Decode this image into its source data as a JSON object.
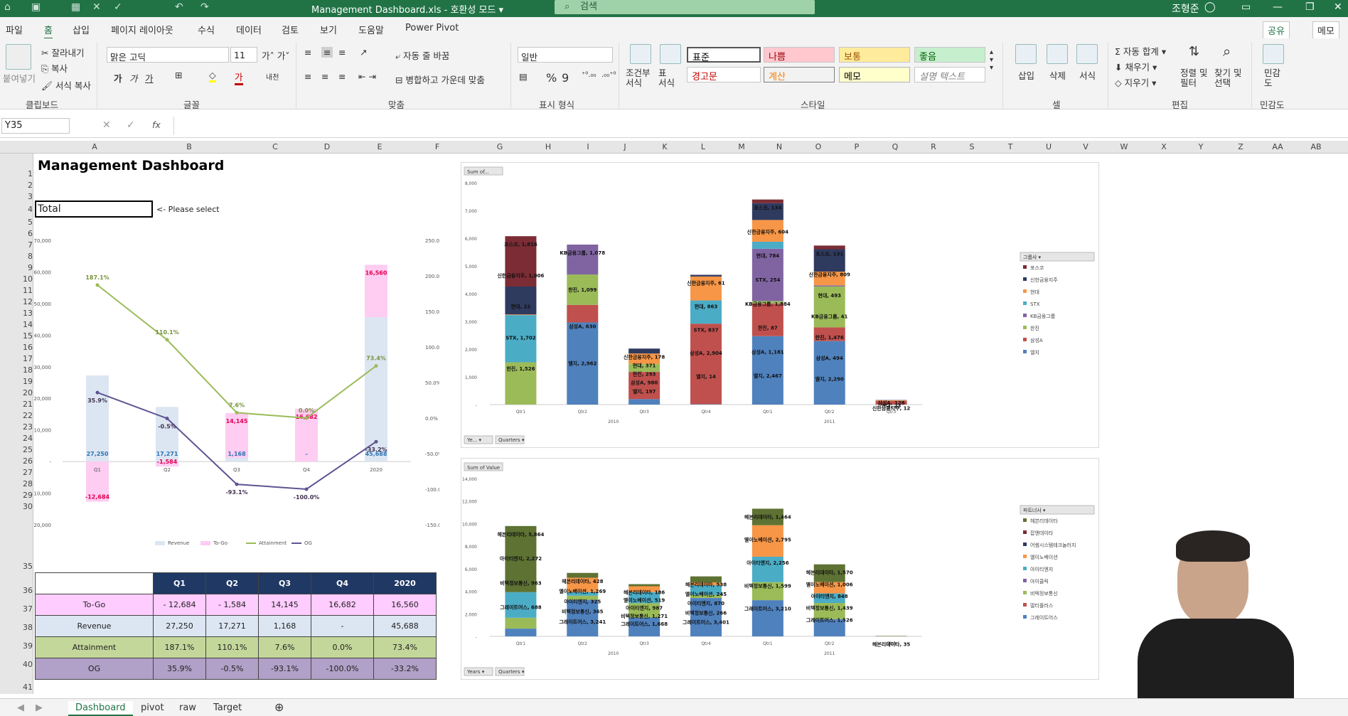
{
  "titlebar": {
    "title": "Management Dashboard.xls  -  호환성 모드  ▾",
    "search_placeholder": "검색",
    "user": "조형준"
  },
  "menu": [
    "파일",
    "홈",
    "삽입",
    "페이지 레이아웃",
    "수식",
    "데이터",
    "검토",
    "보기",
    "도움말",
    "Power Pivot"
  ],
  "share": [
    "공유",
    "메모"
  ],
  "ribbon": {
    "paste": "붙여넣기",
    "cut": "잘라내기",
    "copy": "복사",
    "format_painter": "서식 복사",
    "font_name": "맑은 고딕",
    "font_size": "11",
    "wrap": "자동 줄 바꿈",
    "merge": "병합하고 가운데 맞춤",
    "number_format": "일반",
    "cond_format": "조건부\n서식",
    "table_format": "표\n서식",
    "styles": [
      {
        "label": "표준",
        "color": "#000000",
        "bg": "#ffffff"
      },
      {
        "label": "나쁨",
        "color": "#9c0006",
        "bg": "#ffc7ce"
      },
      {
        "label": "보통",
        "color": "#9c5700",
        "bg": "#ffeb9c"
      },
      {
        "label": "좋음",
        "color": "#006100",
        "bg": "#c6efce"
      },
      {
        "label": "경고문",
        "color": "#c00000",
        "bg": "#ffffff"
      },
      {
        "label": "계산",
        "color": "#fa7d00",
        "bg": "#f2f2f2"
      },
      {
        "label": "메모",
        "color": "#000000",
        "bg": "#ffffcc"
      },
      {
        "label": "설명 텍스트",
        "color": "#7f7f7f",
        "bg": "#ffffff"
      }
    ],
    "insert": "삽입",
    "delete": "삭제",
    "format": "서식",
    "autosum": "자동 합계",
    "fill": "채우기",
    "clear": "지우기",
    "sort": "정렬 및\n필터",
    "find": "찾기 및\n선택",
    "sensitivity": "민감\n도",
    "groups": [
      "클립보드",
      "글꼴",
      "맞춤",
      "표시 형식",
      "스타일",
      "셀",
      "편집",
      "민감도"
    ]
  },
  "formula": {
    "cell": "Y35",
    "fx": "fx"
  },
  "columns": [
    "A",
    "B",
    "C",
    "D",
    "E",
    "F",
    "G",
    "H",
    "I",
    "J",
    "K",
    "L",
    "M",
    "N",
    "O",
    "P",
    "Q",
    "R",
    "S",
    "T",
    "U",
    "V",
    "W",
    "X",
    "Y",
    "Z",
    "AA",
    "AB",
    "AC",
    "AD"
  ],
  "rows": [
    "1",
    "2",
    "3",
    "4",
    "5",
    "6",
    "7",
    "8",
    "9",
    "10",
    "11",
    "12",
    "13",
    "14",
    "15",
    "16",
    "17",
    "18",
    "19",
    "20",
    "21",
    "22",
    "23",
    "24",
    "25",
    "26",
    "27",
    "28",
    "29",
    "30",
    "35",
    "36",
    "37",
    "38",
    "39",
    "40",
    "41"
  ],
  "dashboard": {
    "title": "Management Dashboard",
    "select_value": "Total",
    "select_hint": "<- Please select"
  },
  "combo_chart": {
    "categories": [
      "Q1",
      "Q2",
      "Q3",
      "Q4",
      "2020"
    ],
    "revenue": [
      27250,
      17271,
      1168,
      0,
      45688
    ],
    "to_go": [
      -12684,
      -1584,
      14145,
      16682,
      16560
    ],
    "attainment": [
      187.1,
      110.1,
      7.6,
      0.0,
      73.4
    ],
    "og": [
      35.9,
      -0.5,
      -93.1,
      -100.0,
      -33.2
    ],
    "revenue_labels": [
      "27,250",
      "17,271",
      "1,168",
      "-",
      "45,688"
    ],
    "togo_labels": [
      "-12,684",
      "-1,584",
      "14,145",
      "16,682",
      "16,560"
    ],
    "att_labels": [
      "187.1%",
      "110.1%",
      "7.6%",
      "0.0%",
      "73.4%"
    ],
    "og_labels": [
      "35.9%",
      "-0.5%",
      "-93.1%",
      "-100.0%",
      "-33.2%"
    ],
    "y_left": [
      "70,000",
      "60,000",
      "50,000",
      "40,000",
      "30,000",
      "20,000",
      "10,000",
      "-",
      "-10,000",
      "-20,000"
    ],
    "y_right": [
      "250.0%",
      "200.0%",
      "150.0%",
      "100.0%",
      "50.0%",
      "0.0%",
      "-50.0%",
      "-100.0%",
      "-150.0%"
    ],
    "legend": [
      "Revenue",
      "To-Go",
      "Attainment",
      "OG"
    ],
    "colors": {
      "revenue": "#dce6f2",
      "togo": "#ffccf2",
      "attainment": "#9bbb59",
      "og": "#5f5491"
    }
  },
  "table": {
    "headers": [
      "Q1",
      "Q2",
      "Q3",
      "Q4",
      "2020"
    ],
    "rows": [
      {
        "label": "To-Go",
        "bg": "#ffccff",
        "values": [
          "-      12,684",
          "-      1,584",
          "14,145",
          "16,682",
          "16,560"
        ]
      },
      {
        "label": "Revenue",
        "bg": "#dce6f2",
        "values": [
          "27,250",
          "17,271",
          "1,168",
          "-",
          "45,688"
        ]
      },
      {
        "label": "Attainment",
        "bg": "#c4d79b",
        "values": [
          "187.1%",
          "110.1%",
          "7.6%",
          "0.0%",
          "73.4%"
        ]
      },
      {
        "label": "OG",
        "bg": "#b1a0c7",
        "values": [
          "35.9%",
          "-0.5%",
          "-93.1%",
          "-100.0%",
          "-33.2%"
        ]
      }
    ]
  },
  "pivot1": {
    "field_button": "Sum of...",
    "y_labels": [
      "8,000",
      "7,000",
      "6,000",
      "5,000",
      "4,000",
      "3,000",
      "2,000",
      "1,000",
      "-"
    ],
    "quarters": [
      "Qtr1",
      "Qtr2",
      "Qtr3",
      "Qtr4",
      "Qtr1",
      "Qtr2",
      "Qtr3"
    ],
    "years": [
      "2010",
      "2011"
    ],
    "filters": [
      "Ye...",
      "Quarters"
    ],
    "legend_title": "그룹사",
    "legend": [
      {
        "name": "포스코",
        "color": "#7b2c34"
      },
      {
        "name": "신한금융지주",
        "color": "#2f3a5f"
      },
      {
        "name": "현대",
        "color": "#f79646"
      },
      {
        "name": "STX",
        "color": "#4bacc6"
      },
      {
        "name": "KB금융그룹",
        "color": "#8064a2"
      },
      {
        "name": "한진",
        "color": "#9bbb59"
      },
      {
        "name": "삼성A",
        "color": "#c0504d"
      },
      {
        "name": "엘지",
        "color": "#4f81bd"
      }
    ],
    "labels": [
      [
        "포스코, 1,816",
        "신한금융지주, 1,006",
        "현대, 22",
        "STX, 1,702",
        "한진, 1,526"
      ],
      [
        "KB금융그룹, 1,078",
        "한진, 1,099",
        "삼성A, 630",
        "엘지, 2,962"
      ],
      [
        "신한금융지주, 178",
        "현대, 371",
        "한진, 293",
        "삼성A, 980",
        "엘지, 197"
      ],
      [
        "신한금융지주, 61",
        "현대, 863",
        "STX, 837",
        "삼성A, 2,904",
        "엘지, 14"
      ],
      [
        "포스코, 134",
        "신한금융지주, 604",
        "현대, 784",
        "STX, 254",
        "KB금융그룹, 1,884",
        "한진, 87",
        "삼성A, 1,181",
        "엘지, 2,467"
      ],
      [
        "포스코, 131",
        "신한금융지주, 809",
        "현대, 493",
        "KB금융그룹, 41",
        "한진, 1,476",
        "삼성A, 494",
        "엘지, 2,290"
      ],
      [
        "신한금융지주, 12",
        "현대, 23",
        "삼성A, 128"
      ]
    ]
  },
  "pivot2": {
    "field_button": "Sum of Value",
    "y_labels": [
      "14,000",
      "12,000",
      "10,000",
      "8,000",
      "6,000",
      "4,000",
      "2,000",
      "-"
    ],
    "quarters": [
      "Qtr1",
      "Qtr2",
      "Qtr3",
      "Qtr4",
      "Qtr1",
      "Qtr2",
      "Qtr3"
    ],
    "years": [
      "2010",
      "2011"
    ],
    "filters": [
      "Years",
      "Quarters"
    ],
    "legend_title": "파트너사",
    "legend": [
      {
        "name": "헤븐리데이타",
        "color": "#5e7233"
      },
      {
        "name": "잡앤데이타",
        "color": "#7b2c34"
      },
      {
        "name": "어썸시스템테크놀러지",
        "color": "#2f3a5f"
      },
      {
        "name": "옐이노베이션",
        "color": "#f79646"
      },
      {
        "name": "아이티엔지",
        "color": "#4bacc6"
      },
      {
        "name": "아이클릭",
        "color": "#8064a2"
      },
      {
        "name": "비텍정보통신",
        "color": "#9bbb59"
      },
      {
        "name": "멀티플러스",
        "color": "#c0504d"
      },
      {
        "name": "그레이트어스",
        "color": "#4f81bd"
      }
    ],
    "labels": [
      [
        "헤븐리데이타, 5,864",
        "아이티엔지, 2,272",
        "비텍정보통신, 963",
        "그레이트어스, 688"
      ],
      [
        "헤븐리데이타, 428",
        "옐이노베이션, 1,269",
        "아이티엔지, 325",
        "비텍정보통신, 365",
        "그레이트어스, 3,241"
      ],
      [
        "헤븐리데이타, 186",
        "옐이노베이션, 519",
        "아이티엔지, 987",
        "비텍정보통신, 1,271",
        "그레이트어스, 1,668"
      ],
      [
        "헤븐리데이타, 538",
        "옐이노베이션, 245",
        "아이티엔지, 870",
        "비텍정보통신, 266",
        "그레이트어스, 3,401"
      ],
      [
        "헤븐리데이타, 1,464",
        "옐이노베이션, 2,795",
        "아이티엔지, 2,256",
        "비텍정보통신, 1,599",
        "그레이트어스, 3,210"
      ],
      [
        "헤븐리데이타, 1,570",
        "옐이노베이션, 1,006",
        "아이티엔지, 848",
        "비텍정보통신, 1,439",
        "그레이트어스, 1,526"
      ],
      [
        "헤븐리데이타, 35"
      ]
    ]
  },
  "sheets": [
    "Dashboard",
    "pivot",
    "raw",
    "Target"
  ]
}
